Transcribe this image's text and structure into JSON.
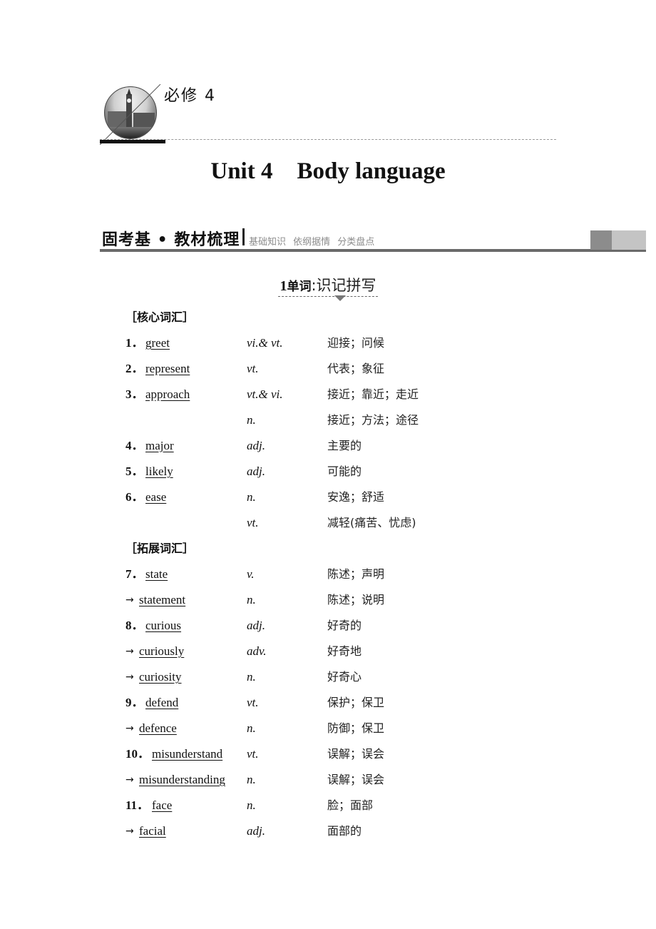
{
  "header": {
    "book_label": "必修 4",
    "emblem": "big-ben-emblem"
  },
  "unit_title": {
    "unit": "Unit 4",
    "topic": "Body language"
  },
  "banner": {
    "main": "固考基 • 教材梳理",
    "sub": "基础知识 依纲据情 分类盘点"
  },
  "sub_heading": {
    "num": "1",
    "bold": "单词",
    "colon": ":",
    "rest": "识记拼写"
  },
  "core": {
    "label": "［核心词汇］",
    "rows": [
      {
        "num": "1．",
        "word": "greet",
        "pos": "vi.& vt.",
        "meaning": "迎接；问候"
      },
      {
        "num": "2．",
        "word": "represent",
        "pos": "vt.",
        "meaning": "代表；象征"
      },
      {
        "num": "3．",
        "word": "approach",
        "pos": "vt.& vi.",
        "meaning": "接近；靠近；走近"
      },
      {
        "num": "",
        "word": "",
        "pos": "n.",
        "meaning": "接近；方法；途径"
      },
      {
        "num": "4．",
        "word": "major",
        "pos": "adj.",
        "meaning": "主要的"
      },
      {
        "num": "5．",
        "word": "likely",
        "pos": "adj.",
        "meaning": "可能的"
      },
      {
        "num": "6．",
        "word": "ease",
        "pos": "n.",
        "meaning": "安逸；舒适"
      },
      {
        "num": "",
        "word": "",
        "pos": "vt.",
        "meaning": "减轻(痛苦、忧虑)"
      }
    ]
  },
  "extended": {
    "label": "［拓展词汇］",
    "arrow": "→",
    "rows": [
      {
        "num": "7．",
        "word": "state",
        "pos": "v.",
        "meaning": "陈述；声明"
      },
      {
        "num": "→",
        "word": "statement",
        "pos": "n.",
        "meaning": "陈述；说明"
      },
      {
        "num": "8．",
        "word": "curious",
        "pos": "adj.",
        "meaning": "好奇的"
      },
      {
        "num": "→",
        "word": "curiously",
        "pos": "adv.",
        "meaning": "好奇地"
      },
      {
        "num": "→",
        "word": "curiosity",
        "pos": "n.",
        "meaning": "好奇心"
      },
      {
        "num": "9．",
        "word": "defend",
        "pos": "vt.",
        "meaning": "保护；保卫"
      },
      {
        "num": "→",
        "word": "defence",
        "pos": "n.",
        "meaning": "防御；保卫"
      },
      {
        "num": "10．",
        "word": "misunderstand",
        "pos": "vt.",
        "meaning": "误解；误会"
      },
      {
        "num": "→",
        "word": "misunderstanding",
        "pos": "n.",
        "meaning": "误解；误会"
      },
      {
        "num": "11．",
        "word": "face",
        "pos": "n.",
        "meaning": "脸；面部"
      },
      {
        "num": "→",
        "word": "facial",
        "pos": "adj.",
        "meaning": "面部的"
      }
    ]
  }
}
